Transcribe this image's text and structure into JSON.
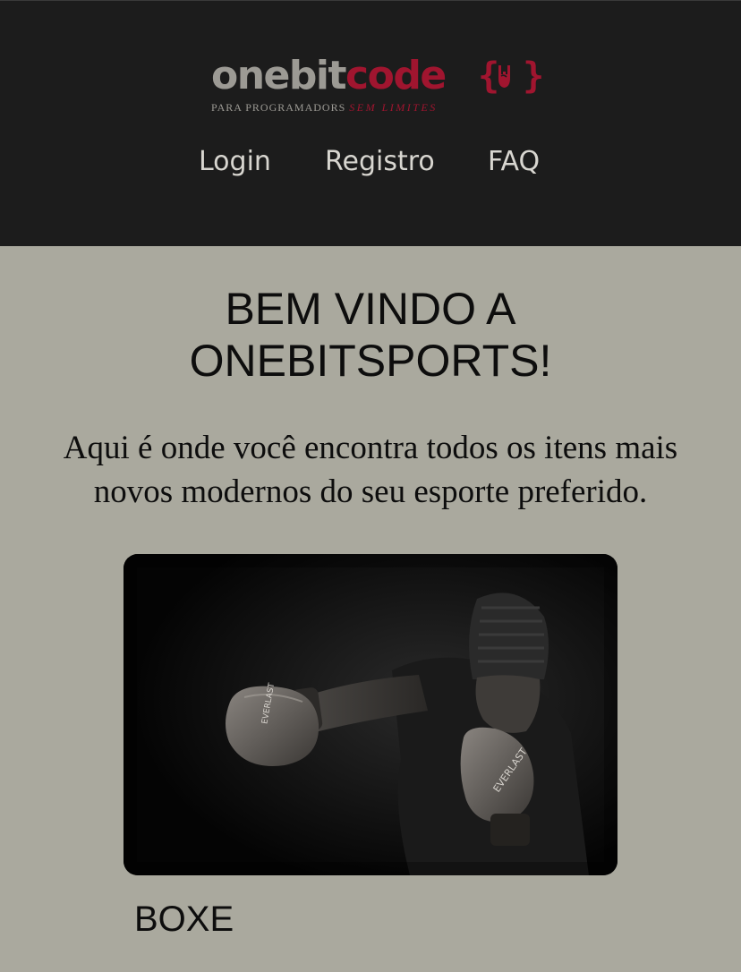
{
  "header": {
    "logo": {
      "part_gray": "onebit",
      "part_red": "code",
      "brace_open": "{",
      "brace_close": "}",
      "tagline_main": "PARA PROGRAMADORS",
      "tagline_accent": "SEM LIMITES"
    },
    "nav": [
      {
        "label": "Login"
      },
      {
        "label": "Registro"
      },
      {
        "label": "FAQ"
      }
    ]
  },
  "main": {
    "title_line1": "BEM VINDO A",
    "title_line2": "ONEBITSPORTS!",
    "intro_line1": "Aqui é onde você encontra todos os itens mais",
    "intro_line2": "novos modernos do seu esporte preferido.",
    "cards": [
      {
        "label": "BOXE",
        "image_icon": "boxer-photo"
      }
    ]
  },
  "colors": {
    "header_bg": "#1c1c1c",
    "page_bg": "#aaa99e",
    "brand_red": "#a0152f",
    "brand_gray": "#9c9a94",
    "nav_text": "#d8d6d0"
  }
}
